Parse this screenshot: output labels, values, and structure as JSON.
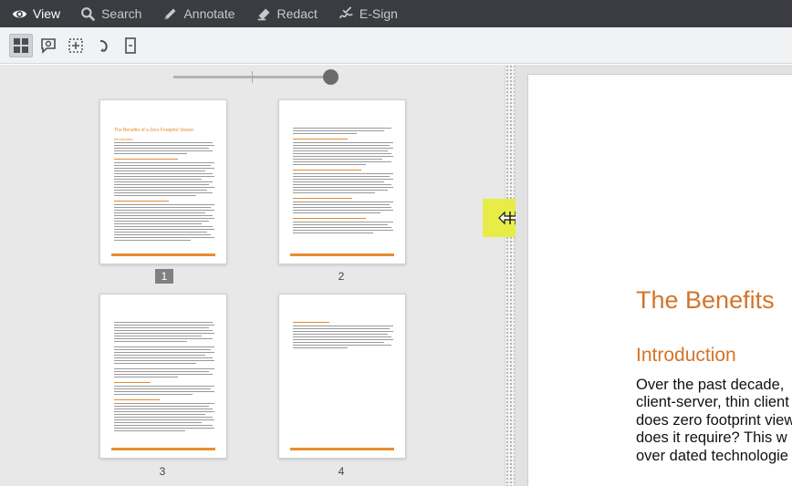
{
  "menubar": {
    "items": [
      {
        "label": "View",
        "icon": "eye-icon"
      },
      {
        "label": "Search",
        "icon": "search-icon"
      },
      {
        "label": "Annotate",
        "icon": "pencil-icon"
      },
      {
        "label": "Redact",
        "icon": "redact-icon"
      },
      {
        "label": "E-Sign",
        "icon": "signature-icon"
      }
    ],
    "active": "View",
    "colors": {
      "background": "#3a3c41",
      "text": "#c7c9cc",
      "active_text": "#ffffff"
    }
  },
  "toolbar": {
    "tools": [
      {
        "icon": "thumbnails-grid-icon",
        "active": true
      },
      {
        "icon": "comment-search-icon",
        "active": false
      },
      {
        "icon": "select-region-icon",
        "active": false
      },
      {
        "icon": "rotate-icon",
        "active": false
      },
      {
        "icon": "fit-page-icon",
        "active": false
      }
    ]
  },
  "thumbnails": {
    "zoom_level": 1.0,
    "pages": [
      {
        "number": "1",
        "selected": true,
        "title": "The Benefits of a Zero Footprint Viewer"
      },
      {
        "number": "2",
        "selected": false
      },
      {
        "number": "3",
        "selected": false
      },
      {
        "number": "4",
        "selected": false
      }
    ]
  },
  "document": {
    "title": "The Benefits",
    "heading": "Introduction",
    "paragraph_lines": [
      "Over the past decade,",
      "client-server, thin client",
      "does zero footprint view",
      "does it require? This w",
      "over dated technologie"
    ],
    "accent_color": "#d4742a"
  }
}
